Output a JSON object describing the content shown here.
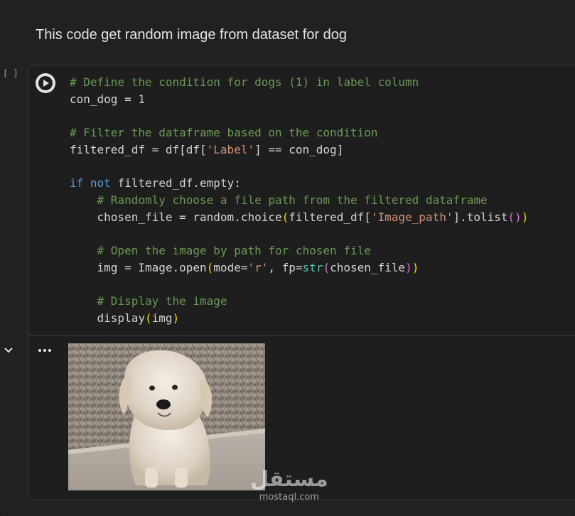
{
  "markdown": {
    "text": "This code get random image from dataset for dog"
  },
  "cell": {
    "execution_count": "[ ]",
    "run_button": "run-cell"
  },
  "code_lines": {
    "l1": "# Define the condition for dogs (1) in label column",
    "l2_a": "con_dog = ",
    "l2_b": "1",
    "l4": "# Filter the dataframe based on the condition",
    "l5_a": "filtered_df = df[df[",
    "l5_b": "'Label'",
    "l5_c": "] == con_dog]",
    "l7_a": "if",
    "l7_b": " ",
    "l7_c": "not",
    "l7_d": " filtered_df.empty:",
    "l8": "    # Randomly choose a file path from the filtered dataframe",
    "l9_a": "    chosen_file = random.choice",
    "l9_b": "(",
    "l9_c": "filtered_df[",
    "l9_d": "'Image_path'",
    "l9_e": "].tolist",
    "l9_f": "()",
    "l9_g": ")",
    "l11": "    # Open the image by path for chosen file",
    "l12_a": "    img = Image.open",
    "l12_b": "(",
    "l12_c": "mode=",
    "l12_d": "'r'",
    "l12_e": ", fp=",
    "l12_f": "str",
    "l12_g": "(",
    "l12_h": "chosen_file",
    "l12_i": ")",
    "l12_j": ")",
    "l14": "    # Display the image",
    "l15_a": "    display",
    "l15_b": "(",
    "l15_c": "img",
    "l15_d": ")"
  },
  "output": {
    "menu_icon": "more-horiz-icon",
    "collapse_icon": "chevron-down-icon",
    "image_subject": "dog"
  },
  "watermark": {
    "arabic": "مستقل",
    "latin": "mostaql.com"
  },
  "colors": {
    "comment": "#6a9955",
    "keyword": "#569cd6",
    "string": "#ce9178",
    "background": "#1e1e1e"
  }
}
